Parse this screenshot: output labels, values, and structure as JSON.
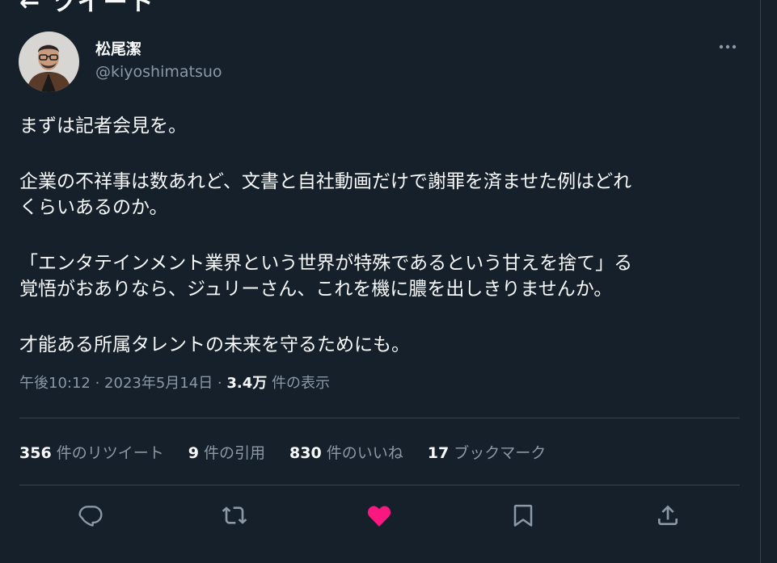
{
  "header": {
    "title": "← ツイート"
  },
  "author": {
    "display_name": "松尾潔",
    "handle": "@kiyoshimatsuo"
  },
  "tweet": {
    "lines": [
      "まずは記者会見を。",
      "企業の不祥事は数あれど、文書と自社動画だけで謝罪を済ませた例はどれ",
      "くらいあるのか。",
      "「エンタテインメント業界という世界が特殊であるという甘えを捨て」る",
      "覚悟がおありなら、ジュリーさん、これを機に膿を出しきりませんか。",
      "才能ある所属タレントの未来を守るためにも。"
    ]
  },
  "meta": {
    "timestamp": "午後10:12 · 2023年5月14日 · ",
    "views_count": "3.4万",
    "views_label": " 件の表示"
  },
  "stats": {
    "retweets": {
      "count": "356",
      "label": " 件のリツイート"
    },
    "quotes": {
      "count": "9",
      "label": " 件の引用"
    },
    "likes": {
      "count": "830",
      "label": " 件のいいね"
    },
    "bookmarks": {
      "count": "17",
      "label": " ブックマーク"
    }
  },
  "icons": {
    "more": "more-horizontal-icon",
    "reply": "reply-icon",
    "retweet": "retweet-icon",
    "like": "heart-filled-icon",
    "bookmark": "bookmark-icon",
    "share": "share-icon"
  },
  "colors": {
    "background": "#15202b",
    "text_primary": "#f7f9f9",
    "text_secondary": "#8b98a5",
    "divider": "#38444d",
    "like_active": "#f91880"
  }
}
